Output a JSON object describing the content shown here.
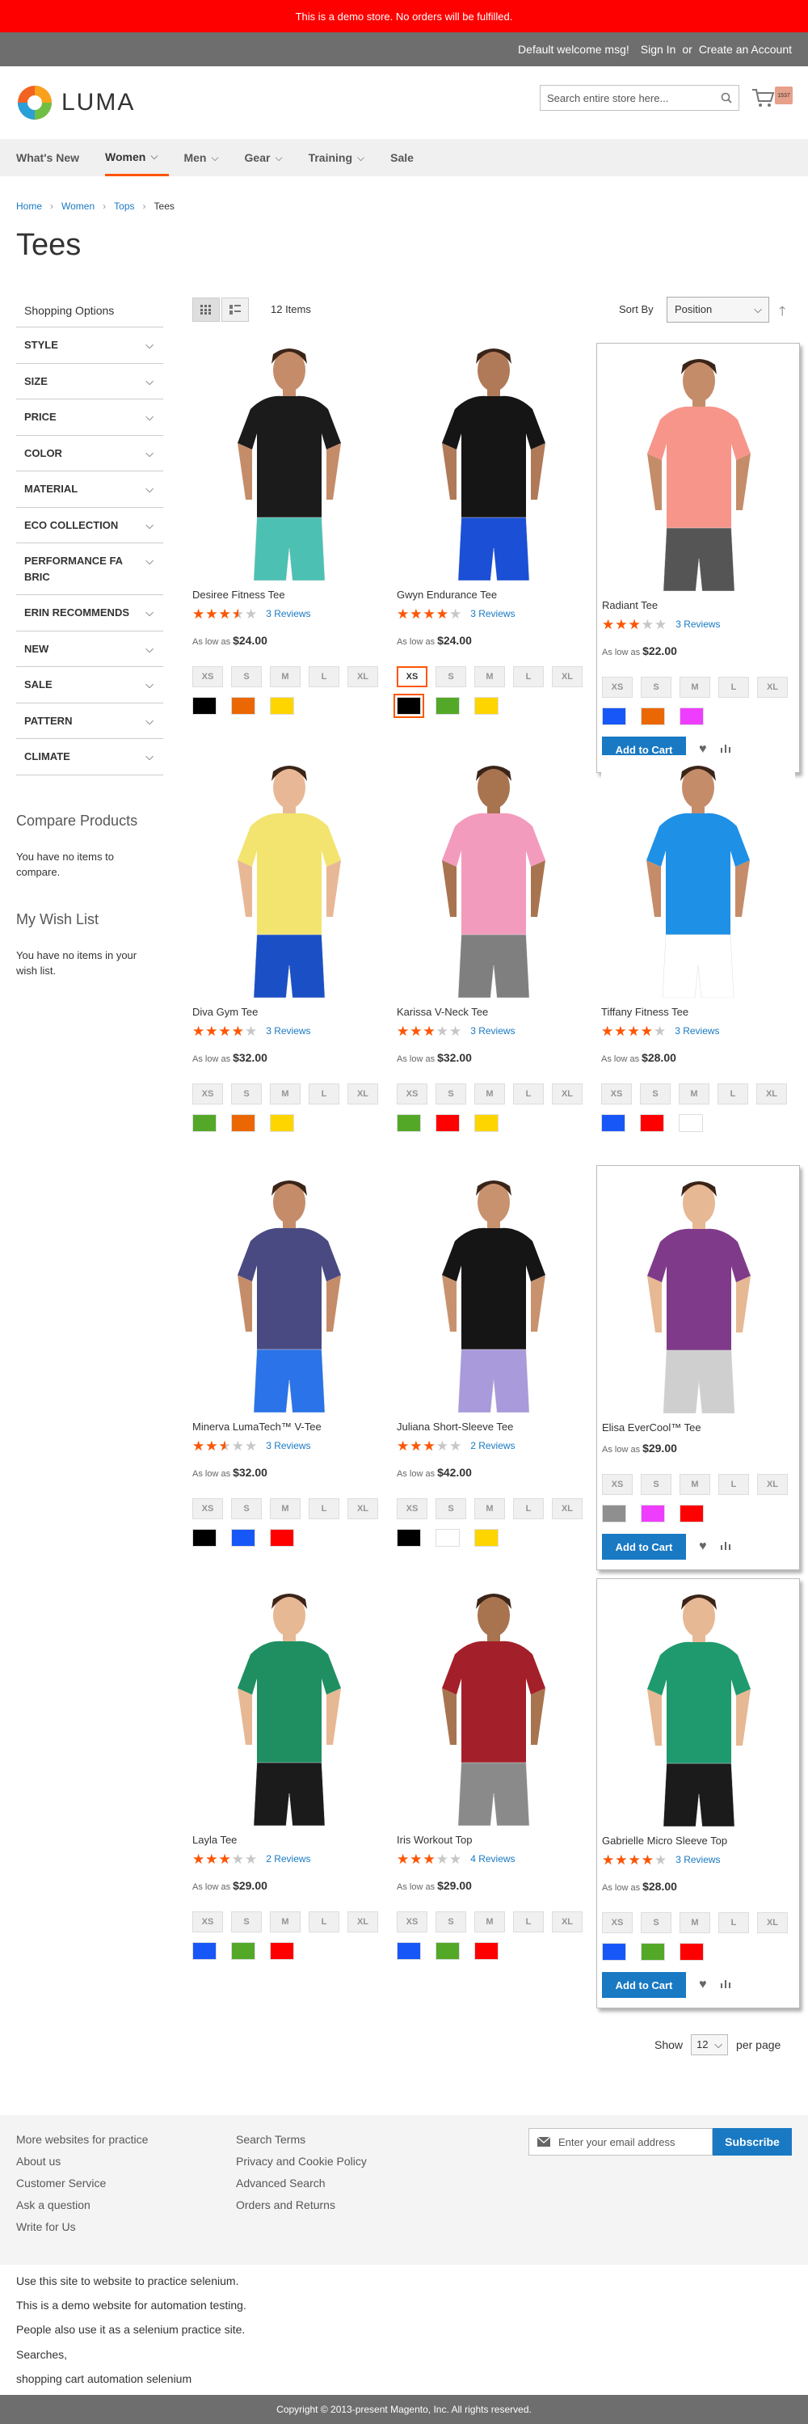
{
  "demo_notice": "This is a demo store. No orders will be fulfilled.",
  "header_links": {
    "welcome": "Default welcome msg!",
    "sign_in": "Sign In",
    "or": "or",
    "create_account": "Create an Account"
  },
  "logo": {
    "text": "LUMA"
  },
  "search": {
    "placeholder": "Search entire store here..."
  },
  "cart": {
    "badge": "1537"
  },
  "nav": [
    {
      "label": "What's New",
      "has_menu": false
    },
    {
      "label": "Women",
      "has_menu": true,
      "active": true
    },
    {
      "label": "Men",
      "has_menu": true
    },
    {
      "label": "Gear",
      "has_menu": true
    },
    {
      "label": "Training",
      "has_menu": true
    },
    {
      "label": "Sale",
      "has_menu": false
    }
  ],
  "breadcrumb": [
    "Home",
    "Women",
    "Tops",
    "Tees"
  ],
  "page_title": "Tees",
  "sidebar": {
    "title": "Shopping Options",
    "filters": [
      "STYLE",
      "SIZE",
      "PRICE",
      "COLOR",
      "MATERIAL",
      "ECO COLLECTION",
      "PERFORMANCE FABRIC",
      "ERIN RECOMMENDS",
      "NEW",
      "SALE",
      "PATTERN",
      "CLIMATE"
    ],
    "compare_title": "Compare Products",
    "compare_text": "You have no items to compare.",
    "wishlist_title": "My Wish List",
    "wishlist_text": "You have no items in your wish list."
  },
  "toolbar": {
    "count": "12 Items",
    "sort_label": "Sort By",
    "sort_value": "Position"
  },
  "products": [
    {
      "name": "Desiree Fitness Tee",
      "rating": 0.7,
      "reviews": "3 Reviews",
      "as_low_as": "As low as",
      "price": "$24.00",
      "sizes": [
        "XS",
        "S",
        "M",
        "L",
        "XL"
      ],
      "colors": [
        "#000000",
        "#eb6703",
        "#ffd500"
      ],
      "shirt": "#1b1b1b",
      "bottom": "#4cc0b3",
      "skin": "#c58c6a",
      "hl": false
    },
    {
      "name": "Gwyn Endurance Tee",
      "rating": 0.8,
      "reviews": "3 Reviews",
      "as_low_as": "As low as",
      "price": "$24.00",
      "sizes": [
        "XS",
        "S",
        "M",
        "L",
        "XL"
      ],
      "colors": [
        "#000000",
        "#53a828",
        "#ffd500"
      ],
      "shirt": "#151515",
      "bottom": "#1a4fd6",
      "skin": "#b07a58",
      "hl": false,
      "sel_size": 0,
      "sel_color": 0
    },
    {
      "name": "Radiant Tee",
      "rating": 0.6,
      "reviews": "3 Reviews",
      "as_low_as": "As low as",
      "price": "$22.00",
      "sizes": [
        "XS",
        "S",
        "M",
        "L",
        "XL"
      ],
      "colors": [
        "#1857f7",
        "#eb6703",
        "#ef3dff"
      ],
      "shirt": "#f7958a",
      "bottom": "#555555",
      "skin": "#c58c6a",
      "hl": true,
      "add_to_cart": "Add to Cart"
    },
    {
      "name": "Diva Gym Tee",
      "rating": 0.8,
      "reviews": "3 Reviews",
      "as_low_as": "As low as",
      "price": "$32.00",
      "sizes": [
        "XS",
        "S",
        "M",
        "L",
        "XL"
      ],
      "colors": [
        "#53a828",
        "#eb6703",
        "#ffd500"
      ],
      "shirt": "#f2e46f",
      "bottom": "#1b4fc6",
      "skin": "#e8b896",
      "hl": false
    },
    {
      "name": "Karissa V-Neck Tee",
      "rating": 0.6,
      "reviews": "3 Reviews",
      "as_low_as": "As low as",
      "price": "$32.00",
      "sizes": [
        "XS",
        "S",
        "M",
        "L",
        "XL"
      ],
      "colors": [
        "#53a828",
        "#ff0000",
        "#ffd500"
      ],
      "shirt": "#f39bbd",
      "bottom": "#7f7f7f",
      "skin": "#a8744f",
      "hl": false
    },
    {
      "name": "Tiffany Fitness Tee",
      "rating": 0.8,
      "reviews": "3 Reviews",
      "as_low_as": "As low as",
      "price": "$28.00",
      "sizes": [
        "XS",
        "S",
        "M",
        "L",
        "XL"
      ],
      "colors": [
        "#1857f7",
        "#ff0000",
        "#ffffff"
      ],
      "shirt": "#1e90e6",
      "bottom": "#ffffff",
      "skin": "#c58c6a",
      "hl": false
    },
    {
      "name": "Minerva LumaTech™ V-Tee",
      "rating": 0.5,
      "reviews": "3 Reviews",
      "as_low_as": "As low as",
      "price": "$32.00",
      "sizes": [
        "XS",
        "S",
        "M",
        "L",
        "XL"
      ],
      "colors": [
        "#000000",
        "#1857f7",
        "#ff0000"
      ],
      "shirt": "#4a4a82",
      "bottom": "#2a73e8",
      "skin": "#c58c6a",
      "hl": false
    },
    {
      "name": "Juliana Short-Sleeve Tee",
      "rating": 0.6,
      "reviews": "2 Reviews",
      "as_low_as": "As low as",
      "price": "$42.00",
      "sizes": [
        "XS",
        "S",
        "M",
        "L",
        "XL"
      ],
      "colors": [
        "#000000",
        "#ffffff",
        "#ffd500"
      ],
      "shirt": "#151515",
      "bottom": "#a89adb",
      "skin": "#c8926e",
      "hl": false
    },
    {
      "name": "Elisa EverCool™ Tee",
      "rating": 0,
      "reviews": "",
      "as_low_as": "As low as",
      "price": "$29.00",
      "sizes": [
        "XS",
        "S",
        "M",
        "L",
        "XL"
      ],
      "colors": [
        "#8f8f8f",
        "#ef3dff",
        "#ff0000"
      ],
      "shirt": "#7f3b8a",
      "bottom": "#cfcfcf",
      "skin": "#e7b894",
      "hl": true,
      "add_to_cart": "Add to Cart"
    },
    {
      "name": "Layla Tee",
      "rating": 0.6,
      "reviews": "2 Reviews",
      "as_low_as": "As low as",
      "price": "$29.00",
      "sizes": [
        "XS",
        "S",
        "M",
        "L",
        "XL"
      ],
      "colors": [
        "#1857f7",
        "#53a828",
        "#ff0000"
      ],
      "shirt": "#1f8f62",
      "bottom": "#1b1b1b",
      "skin": "#e7b894",
      "hl": false
    },
    {
      "name": "Iris Workout Top",
      "rating": 0.6,
      "reviews": "4 Reviews",
      "as_low_as": "As low as",
      "price": "$29.00",
      "sizes": [
        "XS",
        "S",
        "M",
        "L",
        "XL"
      ],
      "colors": [
        "#1857f7",
        "#53a828",
        "#ff0000"
      ],
      "shirt": "#a3202a",
      "bottom": "#8a8a8a",
      "skin": "#a8744f",
      "hl": false
    },
    {
      "name": "Gabrielle Micro Sleeve Top",
      "rating": 0.8,
      "reviews": "3 Reviews",
      "as_low_as": "As low as",
      "price": "$28.00",
      "sizes": [
        "XS",
        "S",
        "M",
        "L",
        "XL"
      ],
      "colors": [
        "#1857f7",
        "#53a828",
        "#ff0000"
      ],
      "shirt": "#1f9a6e",
      "bottom": "#1b1b1b",
      "skin": "#e7b894",
      "hl": true,
      "add_to_cart": "Add to Cart"
    }
  ],
  "perpage": {
    "label": "Show",
    "value": "12",
    "suffix": "per page"
  },
  "footer": {
    "col1": [
      "More websites for practice",
      "About us",
      "Customer Service",
      "Ask a question",
      "Write for Us"
    ],
    "col2": [
      "Search Terms",
      "Privacy and Cookie Policy",
      "Advanced Search",
      "Orders and Returns"
    ],
    "newsletter_placeholder": "Enter your email address",
    "subscribe": "Subscribe"
  },
  "seo_lines": [
    "Use this site to website to practice selenium.",
    "This is a demo website for automation testing.",
    "People also use it as a selenium practice site.",
    "Searches,",
    "shopping cart automation selenium"
  ],
  "copyright": "Copyright © 2013-present Magento, Inc. All rights reserved."
}
